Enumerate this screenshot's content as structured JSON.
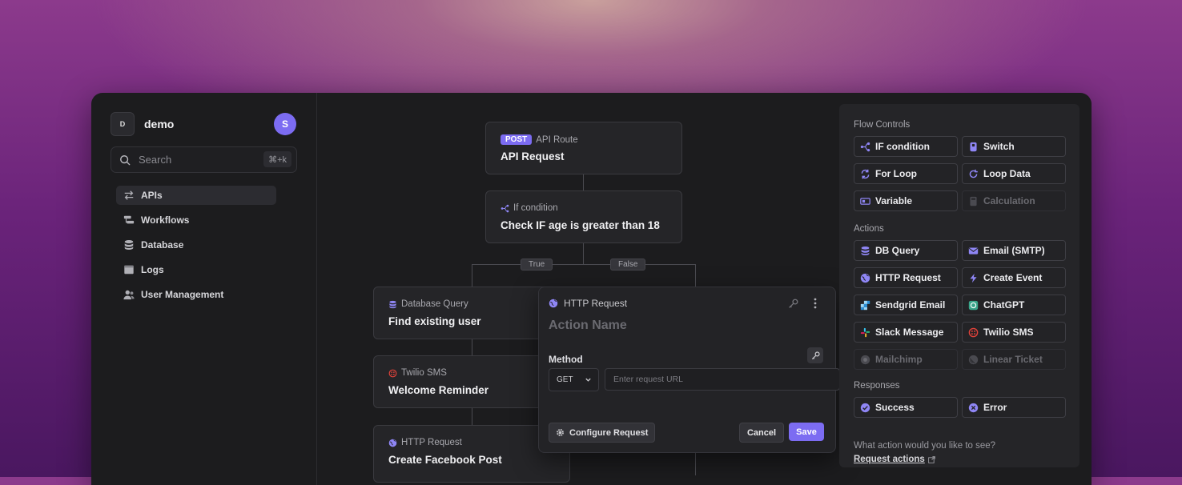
{
  "workspace": {
    "logo": "D",
    "name": "demo",
    "avatar": "S"
  },
  "search": {
    "placeholder": "Search",
    "shortcut": "⌘+k"
  },
  "nav": [
    {
      "label": "APIs",
      "icon": "arrows-swap-icon",
      "active": true
    },
    {
      "label": "Workflows",
      "icon": "workflow-icon"
    },
    {
      "label": "Database",
      "icon": "database-icon"
    },
    {
      "label": "Logs",
      "icon": "logs-icon"
    },
    {
      "label": "User Management",
      "icon": "users-icon"
    }
  ],
  "nodes": {
    "api": {
      "badge": "POST",
      "sub": "API Route",
      "title": "API Request"
    },
    "ifc": {
      "sub": "If condition",
      "title": "Check IF age is greater than 18"
    },
    "db": {
      "sub": "Database Query",
      "title": "Find existing user"
    },
    "twilio": {
      "sub": "Twilio SMS",
      "title": "Welcome Reminder"
    },
    "http": {
      "sub": "HTTP Request",
      "title": "Create Facebook Post"
    }
  },
  "branches": {
    "true_label": "True",
    "false_label": "False"
  },
  "panel": {
    "header": "HTTP Request",
    "action_name_placeholder": "Action Name",
    "method_label": "Method",
    "method_value": "GET",
    "url_placeholder": "Enter request URL",
    "configure_label": "Configure Request",
    "cancel_label": "Cancel",
    "save_label": "Save"
  },
  "palette": {
    "flow_controls_label": "Flow Controls",
    "actions_label": "Actions",
    "responses_label": "Responses",
    "flow_controls": [
      {
        "label": "IF condition",
        "icon": "branch-icon"
      },
      {
        "label": "Switch",
        "icon": "switch-icon"
      },
      {
        "label": "For Loop",
        "icon": "loop-icon"
      },
      {
        "label": "Loop Data",
        "icon": "refresh-icon"
      },
      {
        "label": "Variable",
        "icon": "variable-icon"
      },
      {
        "label": "Calculation",
        "icon": "calculator-icon",
        "disabled": true
      }
    ],
    "actions": [
      {
        "label": "DB Query",
        "icon": "database-icon"
      },
      {
        "label": "Email (SMTP)",
        "icon": "mail-icon"
      },
      {
        "label": "HTTP Request",
        "icon": "globe-icon"
      },
      {
        "label": "Create Event",
        "icon": "bolt-icon"
      },
      {
        "label": "Sendgrid Email",
        "icon": "sendgrid-icon"
      },
      {
        "label": "ChatGPT",
        "icon": "chatgpt-icon"
      },
      {
        "label": "Slack Message",
        "icon": "slack-icon"
      },
      {
        "label": "Twilio SMS",
        "icon": "twilio-icon"
      },
      {
        "label": "Mailchimp",
        "icon": "mailchimp-icon",
        "disabled": true
      },
      {
        "label": "Linear Ticket",
        "icon": "linear-icon",
        "disabled": true
      }
    ],
    "responses": [
      {
        "label": "Success",
        "icon": "check-circle-icon"
      },
      {
        "label": "Error",
        "icon": "x-circle-icon"
      }
    ],
    "question": "What action would you like to see?",
    "link_label": "Request actions"
  },
  "colors": {
    "accent": "#7c6cf2",
    "twilio": "#e2423a",
    "chatgpt": "#3aa58a",
    "sendgrid": "#2b8fd6"
  }
}
